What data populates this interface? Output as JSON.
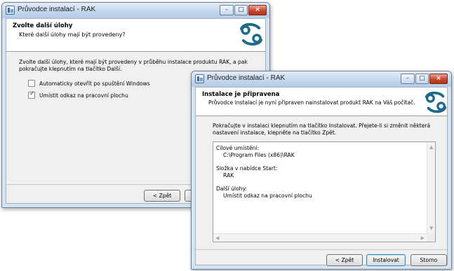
{
  "back_window": {
    "title": "Průvodce instalací - RAK",
    "header_title": "Zvolte další úlohy",
    "header_subtitle": "Které další úlohy mají být provedeny?",
    "instructions_line1": "Zvolte další úlohy, které mají být provedeny v průběhu instalace produktu RAK, a pak",
    "instructions_line2": "pokračujte klepnutím na tlačítko Další.",
    "tasks": [
      {
        "label": "Automaticky otevřít po spuštění Windows",
        "checked": false
      },
      {
        "label": "Umístit odkaz na pracovní plochu",
        "checked": true
      }
    ],
    "back_button": "< Zpět",
    "next_button_partial": "D"
  },
  "front_window": {
    "title": "Průvodce instalací - RAK",
    "header_title": "Instalace je připravena",
    "header_subtitle": "Průvodce instalací je nyní připraven nainstalovat produkt RAK na Váš počítač.",
    "instructions_line1": "Pokračujte v instalaci klepnutím na tlačítko Instalovat. Přejete-li si změnit některá",
    "instructions_line2": "nastavení instalace, klepněte na tlačítko Zpět.",
    "summary": {
      "dest_label": "Cílové umístění:",
      "dest_value": "C:\\Program Files (x86)\\RAK",
      "startmenu_label": "Složka v nabídce Start:",
      "startmenu_value": "RAK",
      "tasks_label": "Další úlohy:",
      "tasks_value": "Umístit odkaz na pracovní plochu"
    },
    "back_button": "< Zpět",
    "install_button": "Instalovat",
    "cancel_button": "Storno"
  },
  "caption_buttons": {
    "minimize": "–",
    "maximize": "□",
    "close": "×"
  },
  "icons": {
    "app": "installer-icon",
    "logo": "cancer-zodiac-logo"
  },
  "colors": {
    "logo": "#1c6b88",
    "titlebar": "#c2d6ec",
    "close": "#c8462f"
  }
}
